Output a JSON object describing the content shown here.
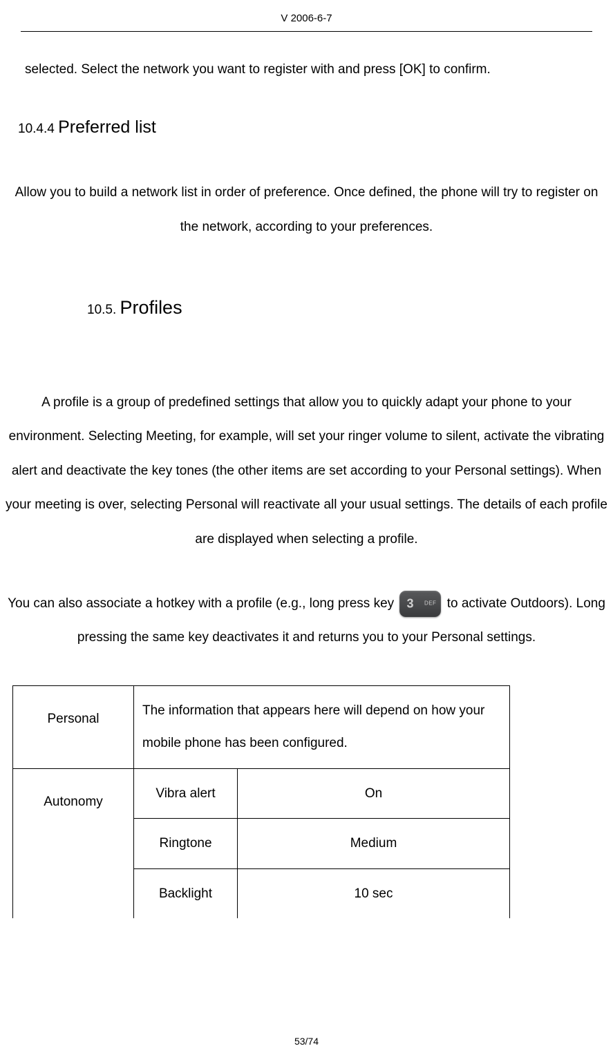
{
  "header": {
    "version": "V 2006-6-7"
  },
  "content": {
    "top_paragraph": "selected. Select the network you want to register with and press [OK] to confirm.",
    "subsection": {
      "number": "10.4.4",
      "title": "Preferred list"
    },
    "preferred_paragraph": "Allow you to build a network list in order of preference. Once defined, the phone will try to register on the network, according to your preferences.",
    "section": {
      "number": "10.5.",
      "title": "Profiles"
    },
    "profiles_paragraph": "A profile is a group of predefined settings that allow you to quickly adapt your phone to your environment. Selecting Meeting, for example, will set your ringer volume to silent, activate the vibrating alert and deactivate the key tones (the other items are set according to your Personal settings). When your meeting is over, selecting Personal will reactivate all your usual settings. The details of each profile are displayed when selecting a profile.",
    "hotkey_before": "You can also associate a hotkey with a profile (e.g., long press key ",
    "hotkey_after": " to activate Outdoors). Long pressing the same key deactivates it and returns you to your Personal settings.",
    "key_label": "3 DEF"
  },
  "table": {
    "rows": [
      {
        "profile": "Personal",
        "description": "The information that appears here will depend on how your mobile phone has been configured."
      },
      {
        "profile": "Autonomy",
        "settings": [
          {
            "name": "Vibra alert",
            "value": "On"
          },
          {
            "name": "Ringtone",
            "value": "Medium"
          },
          {
            "name": "Backlight",
            "value": "10 sec"
          }
        ]
      }
    ]
  },
  "footer": {
    "page": "53/74"
  }
}
